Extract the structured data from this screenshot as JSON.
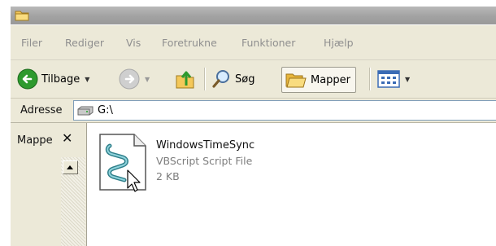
{
  "menubar": {
    "items": [
      "Filer",
      "Rediger",
      "Vis",
      "Foretrukne",
      "Funktioner",
      "Hjælp"
    ]
  },
  "toolbar": {
    "back_label": "Tilbage",
    "search_label": "Søg",
    "folders_label": "Mapper",
    "icons": {
      "back": "back-arrow-icon",
      "forward": "forward-arrow-icon",
      "up": "folder-up-icon",
      "search": "magnifier-icon",
      "folders": "folders-icon",
      "views": "views-icon"
    }
  },
  "address": {
    "label": "Adresse",
    "value": "G:\\",
    "icon": "drive-icon"
  },
  "folder_pane": {
    "title": "Mappe",
    "close_glyph": "✕"
  },
  "file": {
    "name": "WindowsTimeSync",
    "type": "VBScript Script File",
    "size": "2 KB",
    "icon": "vbscript-file-icon"
  },
  "colors": {
    "back_button": "#2e9a2e",
    "window_chrome": "#ece9d8",
    "secondary_text": "#7d7d7d"
  }
}
